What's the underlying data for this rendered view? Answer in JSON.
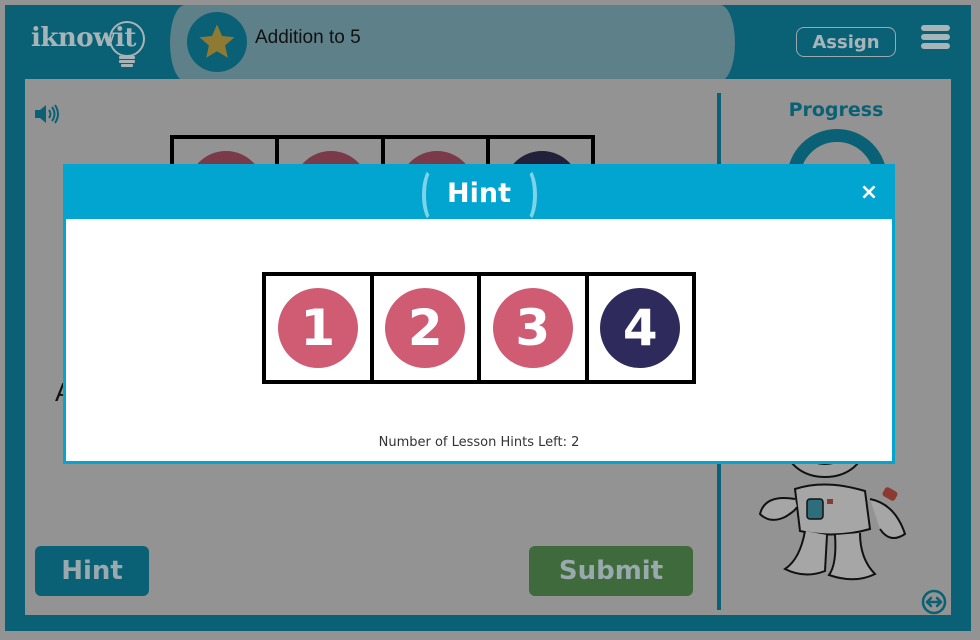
{
  "header": {
    "logo_text": "iknowit",
    "lesson_title": "Addition to 5",
    "assign_label": "Assign"
  },
  "main": {
    "background_frame_colors": [
      "#7a3a4a",
      "#7a3a4a",
      "#7a3a4a",
      "#22203a"
    ],
    "partial_question_text": "A",
    "hint_button_label": "Hint",
    "submit_button_label": "Submit"
  },
  "sidebar": {
    "progress_label": "Progress"
  },
  "modal": {
    "title": "Hint",
    "close_label": "×",
    "ten_frame": [
      {
        "number": "1",
        "color": "#d05c74"
      },
      {
        "number": "2",
        "color": "#d05c74"
      },
      {
        "number": "3",
        "color": "#d05c74"
      },
      {
        "number": "4",
        "color": "#2f2a5c"
      }
    ],
    "hints_left_text": "Number of Lesson Hints Left: 2"
  },
  "colors": {
    "brand_teal": "#0a6175",
    "modal_blue": "#02a5d0",
    "submit_green": "#3f6b3c",
    "overlay_gray": "#939393"
  }
}
